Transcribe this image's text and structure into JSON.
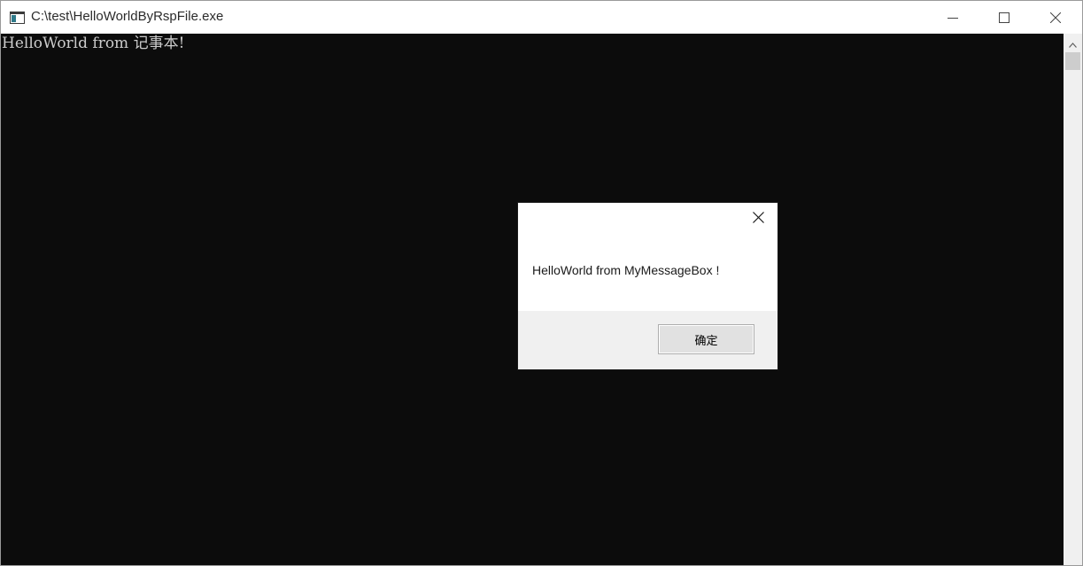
{
  "window": {
    "title": "C:\\test\\HelloWorldByRspFile.exe",
    "icon": "console-app-icon",
    "controls": {
      "minimize": "minimize-icon",
      "maximize": "maximize-icon",
      "close": "close-icon"
    }
  },
  "console": {
    "lines": [
      "HelloWorld from 记事本!"
    ],
    "background": "#0c0c0c",
    "foreground": "#cccccc"
  },
  "message_box": {
    "text": "HelloWorld from MyMessageBox !",
    "ok_label": "确定",
    "close_icon": "close-icon"
  }
}
